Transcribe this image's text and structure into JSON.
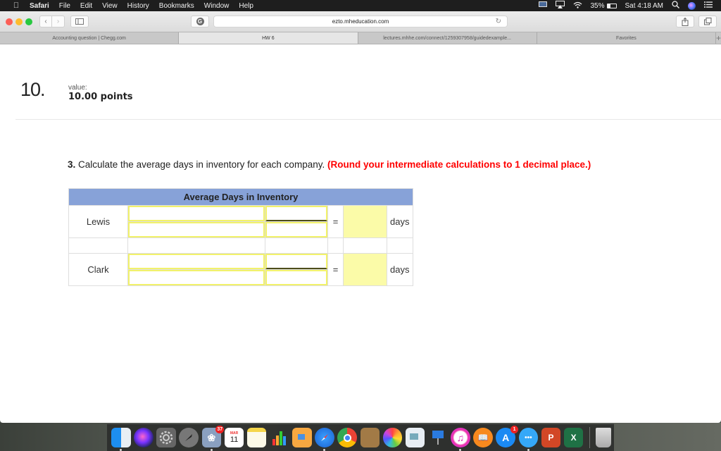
{
  "menubar": {
    "apple": "",
    "app_name": "Safari",
    "menus": [
      "File",
      "Edit",
      "View",
      "History",
      "Bookmarks",
      "Window",
      "Help"
    ],
    "battery_percent": "35%",
    "battery_level": 0.35,
    "clock": "Sat 4:18 AM",
    "status_icons": [
      "display-icon",
      "airplay-icon",
      "wifi-icon",
      "battery-icon",
      "spotlight-icon",
      "siri-icon",
      "notification-center-icon"
    ]
  },
  "browser": {
    "url": "ezto.mheducation.com",
    "tabs": [
      {
        "label": "Accounting question | Chegg.com",
        "active": false
      },
      {
        "label": "HW 6",
        "active": true
      },
      {
        "label": "lectures.mhhe.com/connect/1259307958/guidedexample...",
        "active": false
      },
      {
        "label": "Favorites",
        "active": false
      }
    ],
    "new_tab": "+"
  },
  "question": {
    "number": "10.",
    "value_label": "value:",
    "value_points": "10.00 points",
    "part_number": "3.",
    "instruction": " Calculate the average days in inventory for each company. ",
    "instruction_note": "(Round your intermediate calculations to 1 decimal place.)"
  },
  "table": {
    "header": "Average Days in Inventory",
    "rows": [
      {
        "company": "Lewis",
        "input_a_top": "",
        "input_a_bottom": "",
        "numerator": "",
        "denominator": "",
        "equals": "=",
        "result": "",
        "unit": "days"
      },
      {
        "company": "Clark",
        "input_a_top": "",
        "input_a_bottom": "",
        "numerator": "",
        "denominator": "",
        "equals": "=",
        "result": "",
        "unit": "days"
      }
    ]
  },
  "dock": {
    "apps": [
      {
        "name": "Finder",
        "running": true
      },
      {
        "name": "Siri",
        "running": false
      },
      {
        "name": "System Preferences",
        "running": false
      },
      {
        "name": "Launchpad",
        "running": false
      },
      {
        "name": "Mail",
        "running": true,
        "badge": "37"
      },
      {
        "name": "Calendar",
        "running": false,
        "month": "MAR",
        "day": "11"
      },
      {
        "name": "Notes",
        "running": false
      },
      {
        "name": "Numbers",
        "running": false
      },
      {
        "name": "Pages",
        "running": false
      },
      {
        "name": "Safari",
        "running": true
      },
      {
        "name": "Chrome",
        "running": false
      },
      {
        "name": "Contacts",
        "running": false
      },
      {
        "name": "Photos",
        "running": false
      },
      {
        "name": "Preview",
        "running": false
      },
      {
        "name": "Keynote",
        "running": false
      },
      {
        "name": "iTunes",
        "running": true
      },
      {
        "name": "iBooks",
        "running": false
      },
      {
        "name": "App Store",
        "running": false,
        "badge": "1"
      },
      {
        "name": "Messages",
        "running": true
      },
      {
        "name": "PowerPoint",
        "running": false
      },
      {
        "name": "Excel",
        "running": false
      },
      {
        "name": "Trash",
        "running": false
      }
    ]
  }
}
